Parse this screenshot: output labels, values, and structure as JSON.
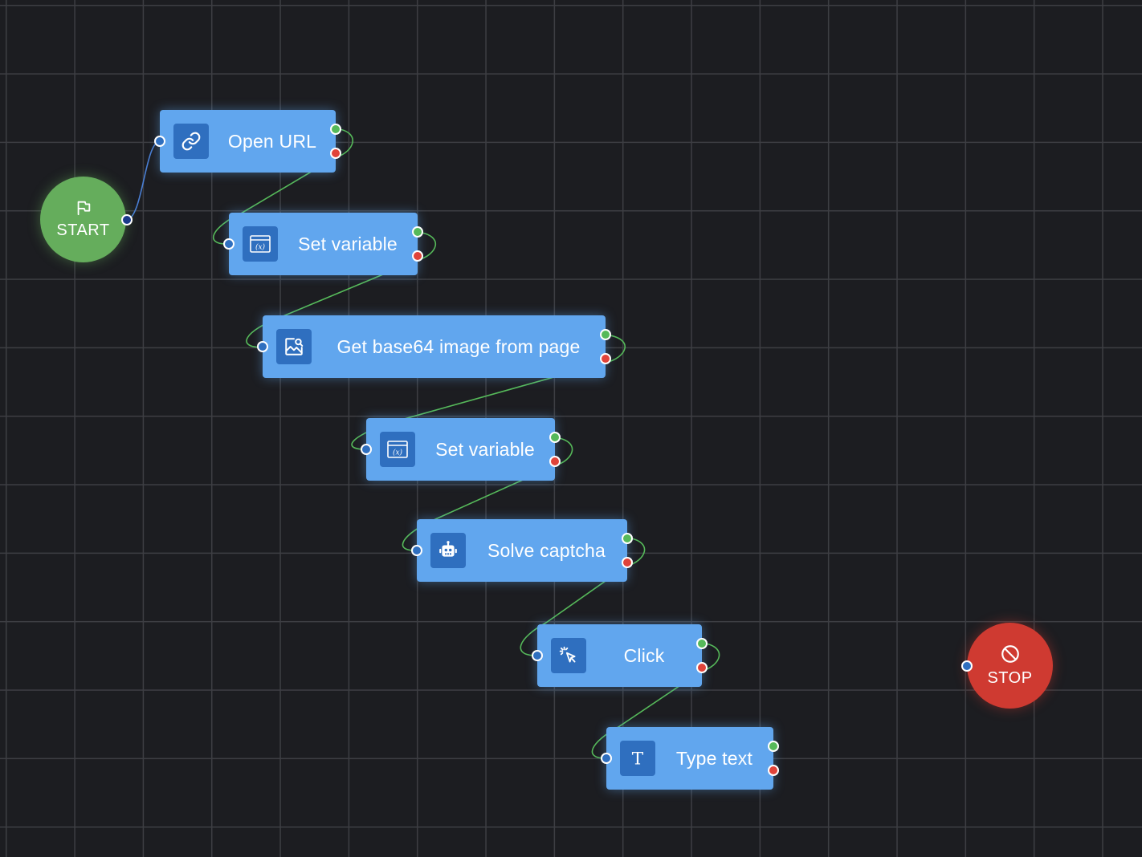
{
  "canvas": {
    "background": "#1c1d21",
    "grid_color": "#3d3e43"
  },
  "colors": {
    "node": "#61a6ee",
    "node_icon_bg": "#2f6fbf",
    "start": "#65ad5c",
    "stop": "#cf3a31",
    "port_success": "#56b95a",
    "port_error": "#e0433a",
    "edge_success": "#56b95a",
    "edge_start": "#4a7fd4"
  },
  "start": {
    "label": "START",
    "icon": "flag-icon"
  },
  "stop": {
    "label": "STOP",
    "icon": "ban-icon"
  },
  "nodes": [
    {
      "id": "open-url",
      "label": "Open URL",
      "icon": "link-icon"
    },
    {
      "id": "set-variable-1",
      "label": "Set variable",
      "icon": "variable-icon"
    },
    {
      "id": "get-base64-image",
      "label": "Get base64 image from page",
      "icon": "image-search-icon"
    },
    {
      "id": "set-variable-2",
      "label": "Set variable",
      "icon": "variable-icon"
    },
    {
      "id": "solve-captcha",
      "label": "Solve captcha",
      "icon": "robot-icon"
    },
    {
      "id": "click",
      "label": "Click",
      "icon": "cursor-click-icon"
    },
    {
      "id": "type-text",
      "label": "Type text",
      "icon": "text-t-icon"
    }
  ],
  "edges": [
    {
      "from": "start",
      "to": "open-url",
      "type": "start"
    },
    {
      "from": "open-url",
      "to": "set-variable-1",
      "type": "success"
    },
    {
      "from": "set-variable-1",
      "to": "get-base64-image",
      "type": "success"
    },
    {
      "from": "get-base64-image",
      "to": "set-variable-2",
      "type": "success"
    },
    {
      "from": "set-variable-2",
      "to": "solve-captcha",
      "type": "success"
    },
    {
      "from": "solve-captcha",
      "to": "click",
      "type": "success"
    },
    {
      "from": "click",
      "to": "type-text",
      "type": "success"
    }
  ]
}
